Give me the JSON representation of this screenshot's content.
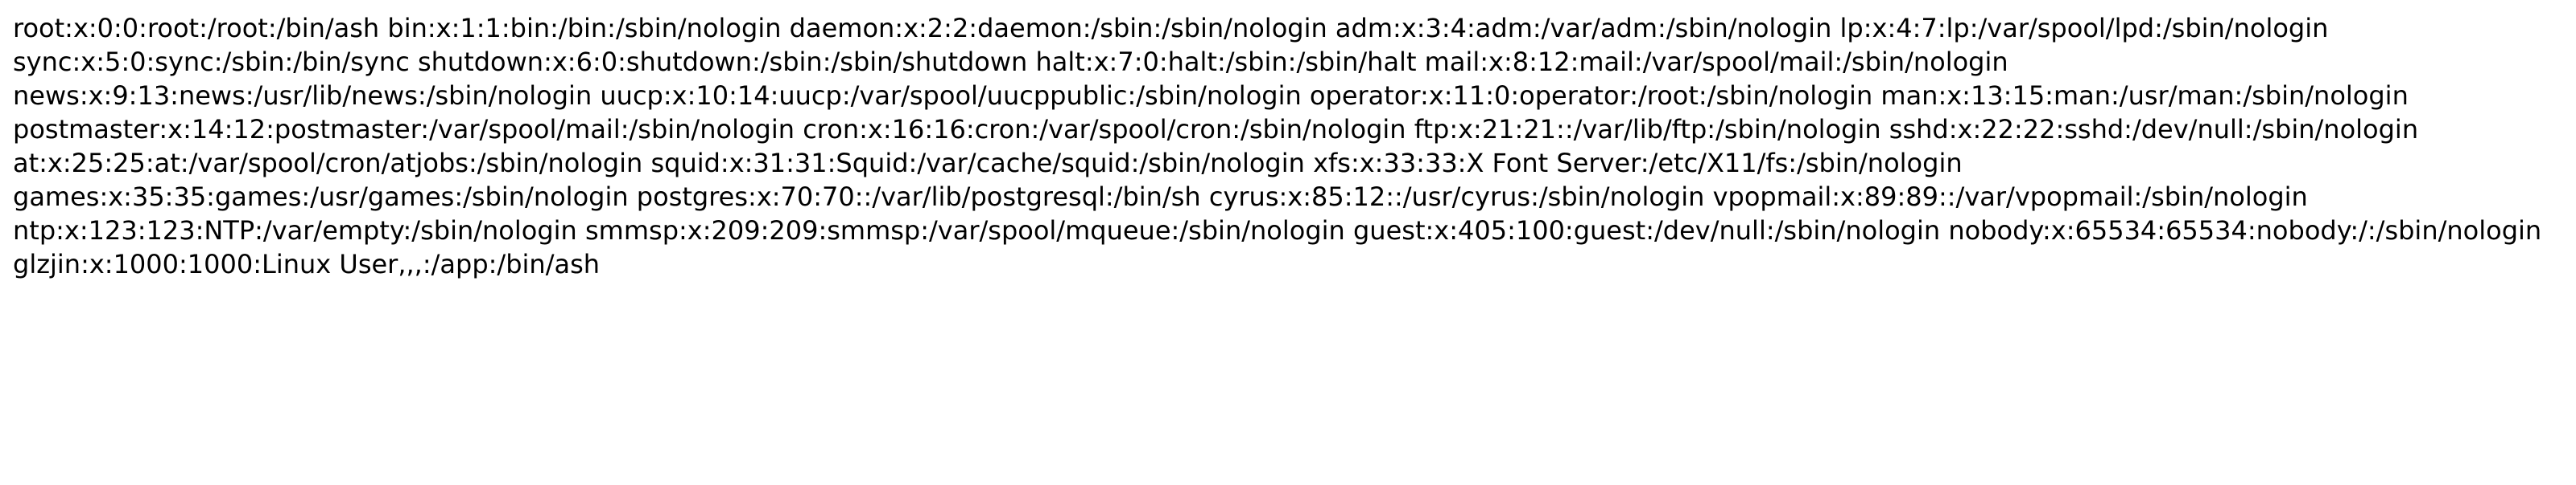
{
  "document": {
    "content": "root:x:0:0:root:/root:/bin/ash bin:x:1:1:bin:/bin:/sbin/nologin daemon:x:2:2:daemon:/sbin:/sbin/nologin adm:x:3:4:adm:/var/adm:/sbin/nologin lp:x:4:7:lp:/var/spool/lpd:/sbin/nologin sync:x:5:0:sync:/sbin:/bin/sync shutdown:x:6:0:shutdown:/sbin:/sbin/shutdown halt:x:7:0:halt:/sbin:/sbin/halt mail:x:8:12:mail:/var/spool/mail:/sbin/nologin news:x:9:13:news:/usr/lib/news:/sbin/nologin uucp:x:10:14:uucp:/var/spool/uucppublic:/sbin/nologin operator:x:11:0:operator:/root:/sbin/nologin man:x:13:15:man:/usr/man:/sbin/nologin postmaster:x:14:12:postmaster:/var/spool/mail:/sbin/nologin cron:x:16:16:cron:/var/spool/cron:/sbin/nologin ftp:x:21:21::/var/lib/ftp:/sbin/nologin sshd:x:22:22:sshd:/dev/null:/sbin/nologin at:x:25:25:at:/var/spool/cron/atjobs:/sbin/nologin squid:x:31:31:Squid:/var/cache/squid:/sbin/nologin xfs:x:33:33:X Font Server:/etc/X11/fs:/sbin/nologin games:x:35:35:games:/usr/games:/sbin/nologin postgres:x:70:70::/var/lib/postgresql:/bin/sh cyrus:x:85:12::/usr/cyrus:/sbin/nologin vpopmail:x:89:89::/var/vpopmail:/sbin/nologin ntp:x:123:123:NTP:/var/empty:/sbin/nologin smmsp:x:209:209:smmsp:/var/spool/mqueue:/sbin/nologin guest:x:405:100:guest:/dev/null:/sbin/nologin nobody:x:65534:65534:nobody:/:/sbin/nologin glzjin:x:1000:1000:Linux User,,,:/app:/bin/ash"
  }
}
